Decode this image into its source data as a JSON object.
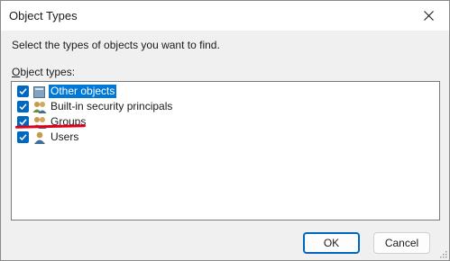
{
  "window": {
    "title": "Object Types"
  },
  "prompt": "Select the types of objects you want to find.",
  "list": {
    "label_prefix": "O",
    "label_rest": "bject types:",
    "items": [
      {
        "label": "Other objects",
        "checked": true,
        "selected": true,
        "icon": "folder-icon"
      },
      {
        "label": "Built-in security principals",
        "checked": true,
        "selected": false,
        "icon": "users-group-icon"
      },
      {
        "label": "Groups",
        "checked": true,
        "selected": false,
        "icon": "users-group-icon"
      },
      {
        "label": "Users",
        "checked": true,
        "selected": false,
        "icon": "user-icon"
      }
    ]
  },
  "buttons": {
    "ok": "OK",
    "cancel": "Cancel"
  },
  "colors": {
    "accent": "#0067c0",
    "selection": "#0078d7",
    "annotation": "#e0001b"
  }
}
